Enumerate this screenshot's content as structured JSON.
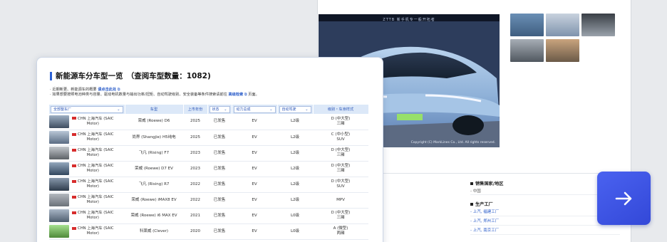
{
  "detail_page": {
    "hero_header": "ZTTB 新手机专一般开拓者",
    "hero_copyright": "Copyright (C) MarkLines Co., Ltd. All rights reserved.",
    "spec_sections": [
      {
        "title": "销售国家/地区",
        "lines": [
          "- 中国"
        ]
      },
      {
        "title": "生产工厂",
        "links": [
          "- 上汽, 福建工厂",
          "- 上汽, 郑州工厂",
          "- 上汽, 南京工厂"
        ]
      }
    ]
  },
  "list_page": {
    "title": "新能源车分车型一览　（查阅车型数量：1082)",
    "notes": [
      {
        "prefix": "· 近期新更、新能源车的概要 ",
        "link": "请点击此处",
        "suffix": ""
      },
      {
        "prefix": "· 如果想要按照电池种类与容量、驱动电机数量与输出功率/扭矩、自动驾驶级别、安全装备等条件搜索请前往 ",
        "link": "高级检索",
        "suffix": " 页面。"
      }
    ],
    "columns": {
      "maker_filter": "全部整车厂",
      "model": "车型",
      "year": "上市年份",
      "status_filter": "状态",
      "powertrain_filter": "动力总成",
      "autonomy_filter": "自动驾驶",
      "class": "级别・车身样式"
    },
    "rows": [
      {
        "maker_line1": "CHN 上海汽车 (SAIC",
        "maker_line2": "Motor)",
        "model": "荣威 (Roewe) D6",
        "year": "2025",
        "status": "已发售",
        "powertrain": "EV",
        "autonomy": "L2级",
        "class1": "D (中大型)",
        "class2": "三厢"
      },
      {
        "maker_line1": "CHN 上海汽车 (SAIC",
        "maker_line2": "Motor)",
        "model": "尚界 (Shangjie) H5纯电",
        "year": "2025",
        "status": "已发售",
        "powertrain": "EV",
        "autonomy": "L2级",
        "class1": "C (中小型)",
        "class2": "SUV"
      },
      {
        "maker_line1": "CHN 上海汽车 (SAIC",
        "maker_line2": "Motor)",
        "model": "飞凡 (Rising) F7",
        "year": "2023",
        "status": "已发售",
        "powertrain": "EV",
        "autonomy": "L2级",
        "class1": "D (中大型)",
        "class2": "三厢"
      },
      {
        "maker_line1": "CHN 上海汽车 (SAIC",
        "maker_line2": "Motor)",
        "model": "荣威 (Roewe) D7 EV",
        "year": "2023",
        "status": "已发售",
        "powertrain": "EV",
        "autonomy": "L2级",
        "class1": "D (中大型)",
        "class2": "三厢"
      },
      {
        "maker_line1": "CHN 上海汽车 (SAIC",
        "maker_line2": "Motor)",
        "model": "飞凡 (Rising) R7",
        "year": "2022",
        "status": "已发售",
        "powertrain": "EV",
        "autonomy": "L2级",
        "class1": "D (中大型)",
        "class2": "SUV"
      },
      {
        "maker_line1": "CHN 上海汽车 (SAIC",
        "maker_line2": "Motor)",
        "model": "荣威 (Roewe) iMAX8 EV",
        "year": "2022",
        "status": "已发售",
        "powertrain": "EV",
        "autonomy": "L2级",
        "class1": "MPV",
        "class2": ""
      },
      {
        "maker_line1": "CHN 上海汽车 (SAIC",
        "maker_line2": "Motor)",
        "model": "荣威 (Roewe) i6 MAX EV",
        "year": "2021",
        "status": "已发售",
        "powertrain": "EV",
        "autonomy": "L0级",
        "class1": "D (中大型)",
        "class2": "三厢"
      },
      {
        "maker_line1": "CHN 上海汽车 (SAIC",
        "maker_line2": "Motor)",
        "model": "科莱威 (Clever)",
        "year": "2020",
        "status": "已发售",
        "powertrain": "EV",
        "autonomy": "L0级",
        "class1": "A (微型)",
        "class2": "两厢"
      }
    ]
  },
  "next_button": {
    "icon": "arrow-right-icon",
    "color": "#3f57e6"
  }
}
